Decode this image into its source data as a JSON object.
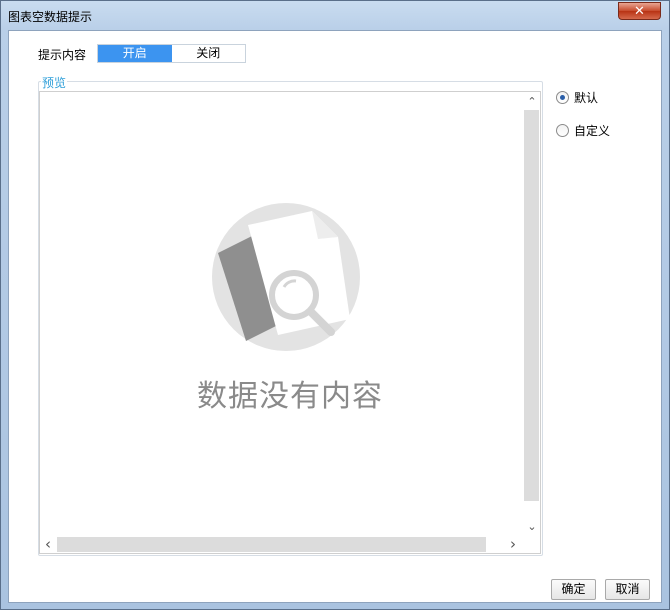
{
  "window": {
    "title": "图表空数据提示",
    "close_label": "✕"
  },
  "prompt": {
    "label": "提示内容",
    "options": [
      {
        "label": "开启",
        "active": true
      },
      {
        "label": "关闭",
        "active": false
      }
    ]
  },
  "preview": {
    "legend": "预览",
    "empty_text": "数据没有内容",
    "scroll_up": "⌃",
    "scroll_down": "⌄",
    "scroll_left": "‹",
    "scroll_right": "›"
  },
  "style_options": [
    {
      "label": "默认",
      "checked": true
    },
    {
      "label": "自定义",
      "checked": false
    }
  ],
  "buttons": {
    "ok": "确定",
    "cancel": "取消"
  },
  "colors": {
    "accent": "#3c94f0",
    "legend": "#2f9fd9",
    "empty_art": "#9b9b9b"
  }
}
